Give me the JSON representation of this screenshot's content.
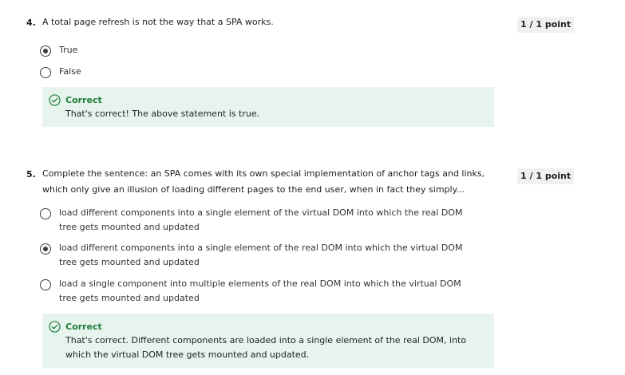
{
  "questions": [
    {
      "number": "4.",
      "text": "A total page refresh is not the way that a SPA works.",
      "points": "1 / 1 point",
      "options": [
        {
          "label": "True",
          "selected": true
        },
        {
          "label": "False",
          "selected": false
        }
      ],
      "feedback": {
        "title": "Correct",
        "text": "That's correct! The above statement is true."
      }
    },
    {
      "number": "5.",
      "text": "Complete the sentence: an SPA comes with its own special implementation of anchor tags and links, which only give an illusion of loading different pages to the end user, when in fact they simply...",
      "points": "1 / 1 point",
      "options": [
        {
          "label": "load different components into a single element of the virtual DOM into which the real DOM tree gets mounted and updated",
          "selected": false
        },
        {
          "label": "load different components into a single element of the real DOM into which the virtual DOM tree gets mounted and updated",
          "selected": true
        },
        {
          "label": "load a single component into multiple elements of the real DOM into which the virtual DOM tree gets mounted and updated",
          "selected": false
        }
      ],
      "feedback": {
        "title": "Correct",
        "text": "That's correct. Different components are loaded into a single element of the real DOM, into which the virtual DOM tree gets mounted and updated."
      }
    }
  ],
  "icons": {
    "radio": "radio-button-icon",
    "feedback": "check-circle-icon"
  },
  "colors": {
    "correct_text": "#1e7d3b",
    "feedback_background": "#e7f4ed",
    "points_background": "#f0f0f0"
  }
}
